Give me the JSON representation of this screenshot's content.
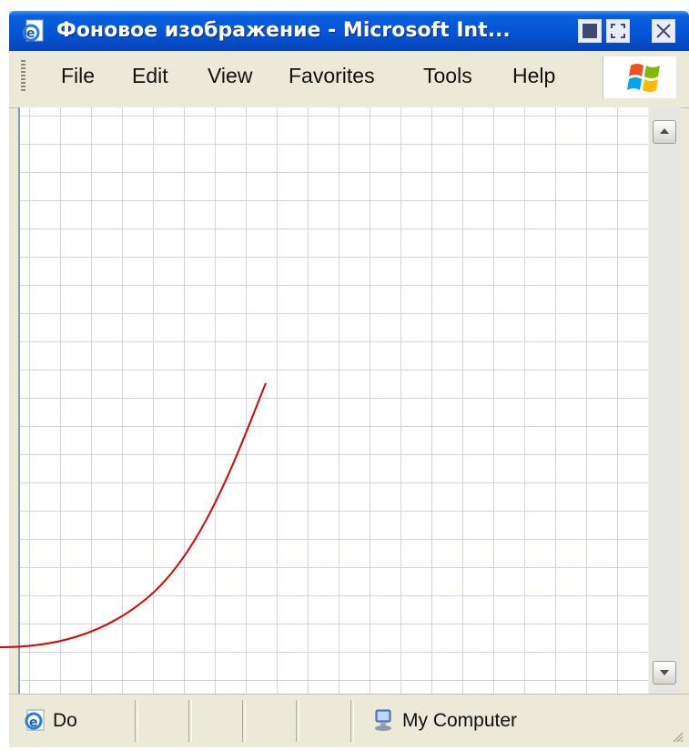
{
  "window": {
    "title": "Фоновое изображение - Microsoft Int..."
  },
  "menu": {
    "items": [
      "File",
      "Edit",
      "View",
      "Favorites",
      "Tools",
      "Help"
    ]
  },
  "status": {
    "text": "Do",
    "zone": "My Computer"
  },
  "icons": {
    "title": "ie-page-icon",
    "minimize": "minimize-icon",
    "maximize": "maximize-icon",
    "close": "close-icon",
    "logo": "windows-logo-icon",
    "status": "ie-icon",
    "zone": "my-computer-icon"
  },
  "colors": {
    "titlebar": "#0555d6",
    "chrome": "#ece9d8",
    "grid": "#d2d4e6",
    "annotation": "#e00000"
  }
}
